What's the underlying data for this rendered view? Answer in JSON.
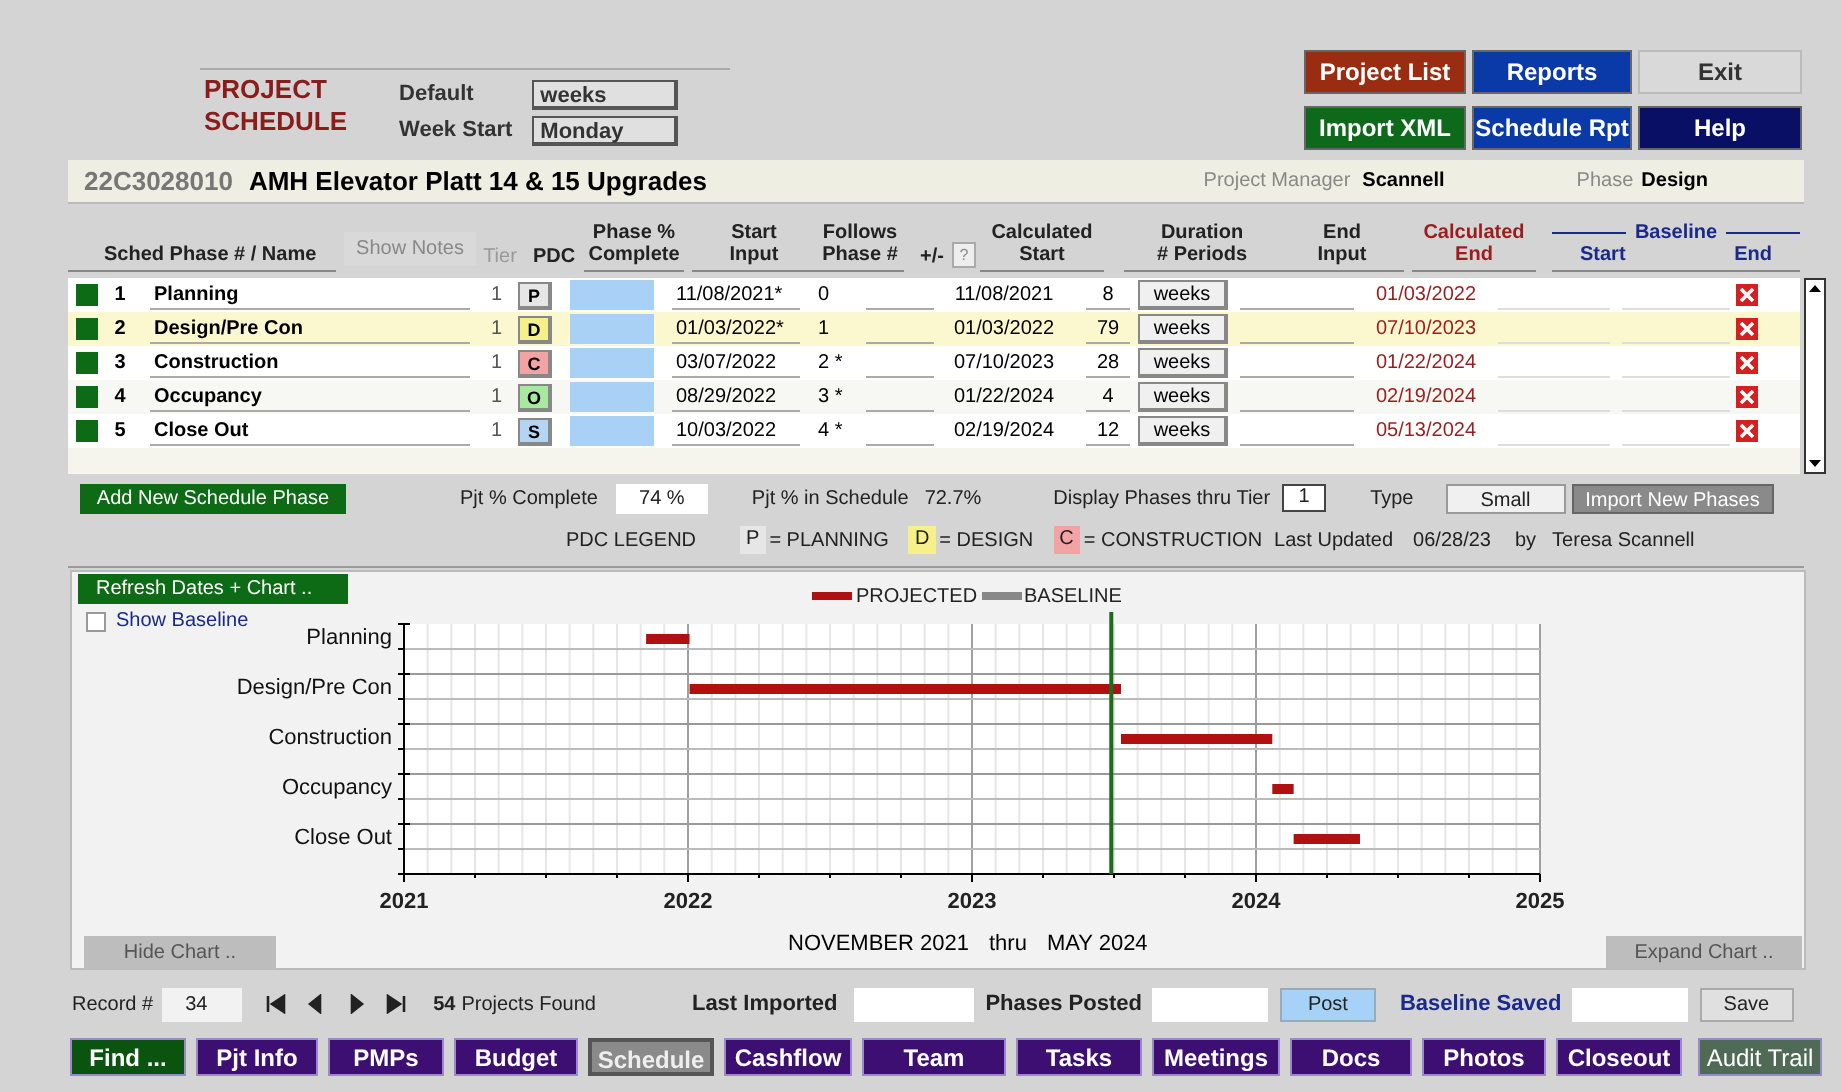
{
  "header": {
    "title_line1": "PROJECT",
    "title_line2": "SCHEDULE",
    "default_label": "Default",
    "default_value": "weeks",
    "week_start_label": "Week Start",
    "week_start_value": "Monday"
  },
  "top_buttons": [
    {
      "label": "Project List",
      "color": "#9a2c12"
    },
    {
      "label": "Reports",
      "color": "#0a3aa8"
    },
    {
      "label": "Exit",
      "color": "#d9d9d9"
    },
    {
      "label": "Import XML",
      "color": "#0d6a1a"
    },
    {
      "label": "Schedule Rpt",
      "color": "#0a3aa8"
    },
    {
      "label": "Help",
      "color": "#0a0f66"
    }
  ],
  "project": {
    "number": "22C3028010",
    "name": "AMH Elevator Platt 14 & 15 Upgrades",
    "manager_label": "Project Manager",
    "manager": "Scannell",
    "phase_label": "Phase",
    "phase": "Design"
  },
  "table": {
    "name_header": "Sched Phase # / Name",
    "show_notes": "Show Notes",
    "tier_header": "Tier",
    "pdc_header": "PDC",
    "complete_header": [
      "Phase %",
      "Complete"
    ],
    "start_header": [
      "Start",
      "Input"
    ],
    "follows_header": [
      "Follows",
      "Phase #"
    ],
    "plusminus_header": "+/-",
    "help_button": "?",
    "calc_start_header": [
      "Calculated",
      "Start"
    ],
    "duration_header": [
      "Duration",
      "# Periods"
    ],
    "end_header": [
      "End",
      "Input"
    ],
    "calc_end_header": [
      "Calculated",
      "End"
    ],
    "baseline_header": "Baseline",
    "baseline_start_header": "Start",
    "baseline_end_header": "End",
    "rows": [
      {
        "num": "1",
        "name": "Planning",
        "tier": "1",
        "pdc": "P",
        "color": "#e6e6e6",
        "start_input": "11/08/2021*",
        "follows": "0",
        "calc_start": "11/08/2021",
        "duration": "8",
        "unit": "weeks",
        "calc_end": "01/03/2022",
        "selected": false
      },
      {
        "num": "2",
        "name": "Design/Pre Con",
        "tier": "1",
        "pdc": "D",
        "color": "#f6f08a",
        "start_input": "01/03/2022*",
        "follows": "1",
        "calc_start": "01/03/2022",
        "duration": "79",
        "unit": "weeks",
        "calc_end": "07/10/2023",
        "selected": true
      },
      {
        "num": "3",
        "name": "Construction",
        "tier": "1",
        "pdc": "C",
        "color": "#f3a3a3",
        "start_input": "03/07/2022",
        "follows": "2 *",
        "calc_start": "07/10/2023",
        "duration": "28",
        "unit": "weeks",
        "calc_end": "01/22/2024",
        "selected": false
      },
      {
        "num": "4",
        "name": "Occupancy",
        "tier": "1",
        "pdc": "O",
        "color": "#a6eaa0",
        "start_input": "08/29/2022",
        "follows": "3 *",
        "calc_start": "01/22/2024",
        "duration": "4",
        "unit": "weeks",
        "calc_end": "02/19/2024",
        "selected": false
      },
      {
        "num": "5",
        "name": "Close Out",
        "tier": "1",
        "pdc": "S",
        "color": "#b4d4f4",
        "start_input": "10/03/2022",
        "follows": "4 *",
        "calc_start": "02/19/2024",
        "duration": "12",
        "unit": "weeks",
        "calc_end": "05/13/2024",
        "selected": false
      }
    ]
  },
  "summary": {
    "add_button": "Add New Schedule Phase",
    "pct_complete_label": "Pjt % Complete",
    "pct_complete": "74 %",
    "pct_schedule_label": "Pjt % in Schedule",
    "pct_schedule": "72.7%",
    "tier_label": "Display Phases thru Tier",
    "tier": "1",
    "type_label": "Type",
    "type": "Small",
    "import_button": "Import New Phases"
  },
  "legend": {
    "label": "PDC LEGEND",
    "items": [
      {
        "letter": "P",
        "text": "= PLANNING",
        "color": "#e6e6e6"
      },
      {
        "letter": "D",
        "text": "= DESIGN",
        "color": "#f6f08a"
      },
      {
        "letter": "C",
        "text": "= CONSTRUCTION",
        "color": "#f3a3a3"
      }
    ],
    "last_updated_label": "Last Updated",
    "last_updated": "06/28/23",
    "by_label": "by",
    "by": "Teresa Scannell"
  },
  "chart": {
    "refresh_button": "Refresh Dates +  Chart ..",
    "show_baseline": {
      "label": "Show Baseline",
      "checked": false
    },
    "legend": [
      "PROJECTED",
      "BASELINE"
    ],
    "row_labels": [
      "Planning",
      "Design/Pre Con",
      "Construction",
      "Occupancy",
      "Close Out"
    ],
    "x_ticks": [
      "2021",
      "2022",
      "2023",
      "2024",
      "2025"
    ],
    "range_from": "NOVEMBER 2021",
    "range_thru": "thru",
    "range_to": "MAY 2024",
    "hide_button": "Hide Chart ..",
    "expand_button": "Expand Chart .."
  },
  "footer": {
    "record_label": "Record #",
    "record": "34",
    "found_count": "54",
    "found_text": "Projects Found",
    "last_imported_label": "Last Imported",
    "phases_posted_label": "Phases Posted",
    "post_button": "Post",
    "baseline_saved_label": "Baseline Saved",
    "save_button": "Save"
  },
  "tabs": [
    {
      "label": "Find ...",
      "color": "#0b5410",
      "selected": false
    },
    {
      "label": "Pjt Info",
      "color": "#3e0f72",
      "selected": false
    },
    {
      "label": "PMPs",
      "color": "#3e0f72",
      "selected": false
    },
    {
      "label": "Budget",
      "color": "#3e0f72",
      "selected": false
    },
    {
      "label": "Schedule",
      "color": "#8a8a8a",
      "selected": true
    },
    {
      "label": "Cashflow",
      "color": "#3e0f72",
      "selected": false
    },
    {
      "label": "Team",
      "color": "#3e0f72",
      "selected": false
    },
    {
      "label": "Tasks",
      "color": "#3e0f72",
      "selected": false
    },
    {
      "label": "Meetings",
      "color": "#3e0f72",
      "selected": false
    },
    {
      "label": "Docs",
      "color": "#3e0f72",
      "selected": false
    },
    {
      "label": "Photos",
      "color": "#3e0f72",
      "selected": false
    },
    {
      "label": "Closeout",
      "color": "#3e0f72",
      "selected": false
    },
    {
      "label": "Audit Trail",
      "color": "#4f6a55",
      "selected": false
    }
  ]
}
